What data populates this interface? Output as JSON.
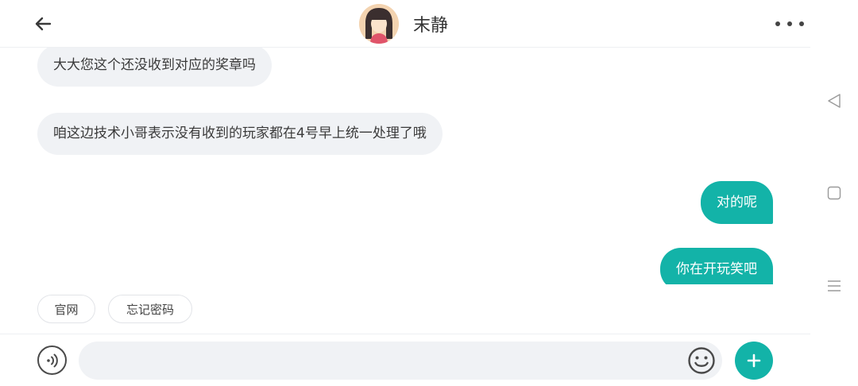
{
  "header": {
    "title": "末静",
    "back_icon": "arrow-left-icon",
    "more_icon": "more-horizontal-icon"
  },
  "messages": [
    {
      "direction": "in",
      "text": "大大您这个还没收到对应的奖章吗"
    },
    {
      "direction": "in",
      "text": "咱这边技术小哥表示没有收到的玩家都在4号早上统一处理了哦"
    },
    {
      "direction": "out",
      "text": "对的呢"
    },
    {
      "direction": "out",
      "text": "你在开玩笑吧"
    }
  ],
  "quick_replies": [
    "官网",
    "忘记密码"
  ],
  "composer": {
    "input_value": "",
    "input_placeholder": "",
    "voice_icon": "voice-icon",
    "emoji_icon": "emoji-icon",
    "plus_icon": "plus-icon"
  },
  "system_nav": {
    "back_icon": "nav-back-icon",
    "home_icon": "nav-home-icon",
    "menu_icon": "nav-menu-icon"
  },
  "colors": {
    "accent": "#13b3a8",
    "bubble_in": "#f0f2f5",
    "text": "#333333"
  }
}
